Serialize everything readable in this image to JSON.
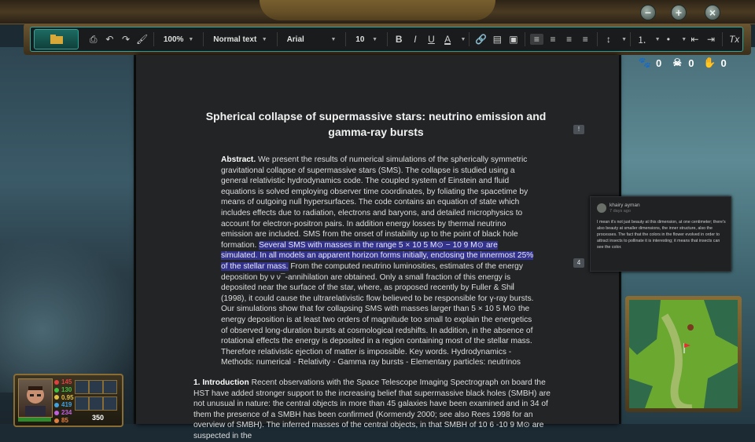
{
  "toolbar": {
    "zoom": "100%",
    "style": "Normal text",
    "font": "Arial",
    "size": "10",
    "bold": "B",
    "italic": "I",
    "underline": "U",
    "text_color": "A",
    "clear_format": "Tx"
  },
  "doc": {
    "title": "Spherical collapse of supermassive stars: neutrino emission and gamma-ray bursts",
    "abstract_label": "Abstract.",
    "abstract_p1": " We present the results of numerical simulations of the spherically symmetric gravitational collapse of supermassive stars (SMS). The collapse is studied using a general relativistic hydrodynamics code. The coupled system of Einstein and fluid equations is solved employing observer time coordinates, by foliating the spacetime by means of outgoing null hypersurfaces. The code contains an equation of state which includes effects due to radiation, electrons and baryons, and detailed microphysics to account for electron-positron pairs. In addition energy losses by thermal neutrino emission are included. SMS from the onset of instability up to the point of black hole formation. ",
    "abstract_highlight": "Several SMS with masses in the range 5 × 10 5 M⊙ − 10 9 M⊙ are simulated. In all models an apparent horizon forms initially, enclosing the innermost 25% of the stellar mass.",
    "abstract_p2": " From the computed neutrino luminosities, estimates of the energy deposition by ν ν¯-annihilation are obtained. Only a small fraction of this energy is deposited near the surface of the star, where, as proposed recently by Fuller & Shi (1998), it could cause the ultrarelativistic flow believed to be responsible for γ-ray bursts. Our simulations show that for collapsing SMS with masses larger than 5 × 10 5 M⊙ the energy deposition is at least two orders of magnitude too small to explain the energetics of observed long-duration bursts at cosmological redshifts. In addition, in the absence of rotational effects the energy is deposited in a region containing most of the stellar mass. Therefore relativistic ejection of matter is impossible. Key words. Hydrodynamics - Methods: numerical - Relativity - Gamma ray bursts - Elementary particles: neutrinos",
    "intro_label": "1. Introduction",
    "intro_text": " Recent observations with the Space Telescope Imaging Spectrograph on board the HST have added stronger support to the increasing belief that supermassive black holes (SMBH) are not unusual in nature: the central objects in more than 45 galaxies have been examined and in 34 of them the presence of a SMBH has been confirmed (Kormendy 2000; see also Rees 1998 for an overview of SMBH). The inferred masses of the central objects, in that SMBH of 10 6 -10 9 M⊙ are suspected in the",
    "marker1": "!",
    "marker2": "4"
  },
  "comment": {
    "author": "khairy ayman",
    "date": "7 days ago",
    "text": "I mean it's not just beauty at this dimension, at one centimeter; there's also beauty at smaller dimensions, the inner structure, also the processes. The fact that the colors in the flower evolved in order to attract insects to pollinate it is interesting; it means that insects can see the color."
  },
  "counters": [
    {
      "icon": "paw-icon",
      "value": "0"
    },
    {
      "icon": "skull-icon",
      "value": "0"
    },
    {
      "icon": "hand-icon",
      "value": "0"
    }
  ],
  "hud": {
    "stats": [
      "145",
      "130",
      "0.95",
      "419",
      "234",
      "85"
    ],
    "stat_colors": [
      "#e04040",
      "#40c040",
      "#e0c040",
      "#40a0e0",
      "#c060e0",
      "#e08040"
    ],
    "gold": "350"
  },
  "colors": {
    "accent": "#2ea59a",
    "highlight": "#33328a",
    "frame_gold": "#8a6d35"
  }
}
